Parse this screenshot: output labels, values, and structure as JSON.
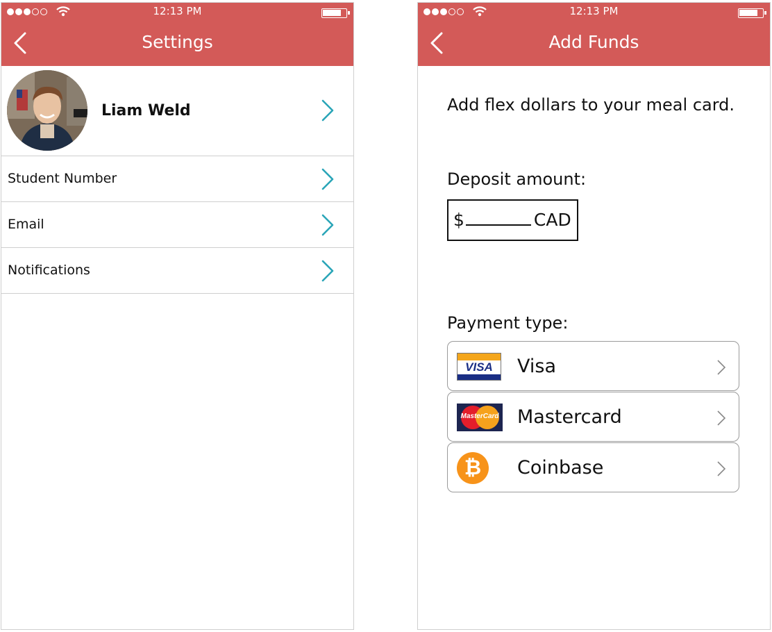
{
  "settings_screen": {
    "status": {
      "time": "12:13 PM"
    },
    "header": {
      "title": "Settings"
    },
    "profile": {
      "name": "Liam Weld"
    },
    "rows": [
      {
        "label": "Student Number"
      },
      {
        "label": "Email"
      },
      {
        "label": "Notifications"
      }
    ]
  },
  "add_funds_screen": {
    "status": {
      "time": "12:13 PM"
    },
    "header": {
      "title": "Add Funds"
    },
    "intro": "Add flex dollars to your meal card.",
    "deposit_label": "Deposit amount:",
    "amount": {
      "prefix": "$",
      "currency": "CAD"
    },
    "payment_label": "Payment type:",
    "payment_options": [
      {
        "name": "Visa",
        "logo_text": "VISA",
        "icon": "visa-logo"
      },
      {
        "name": "Mastercard",
        "logo_text": "MasterCard",
        "icon": "mastercard-logo"
      },
      {
        "name": "Coinbase",
        "logo_text": "₿",
        "icon": "bitcoin-logo"
      }
    ]
  },
  "colors": {
    "header": "#d35a58",
    "chevron": "#2aa5b8",
    "text": "#111111"
  }
}
